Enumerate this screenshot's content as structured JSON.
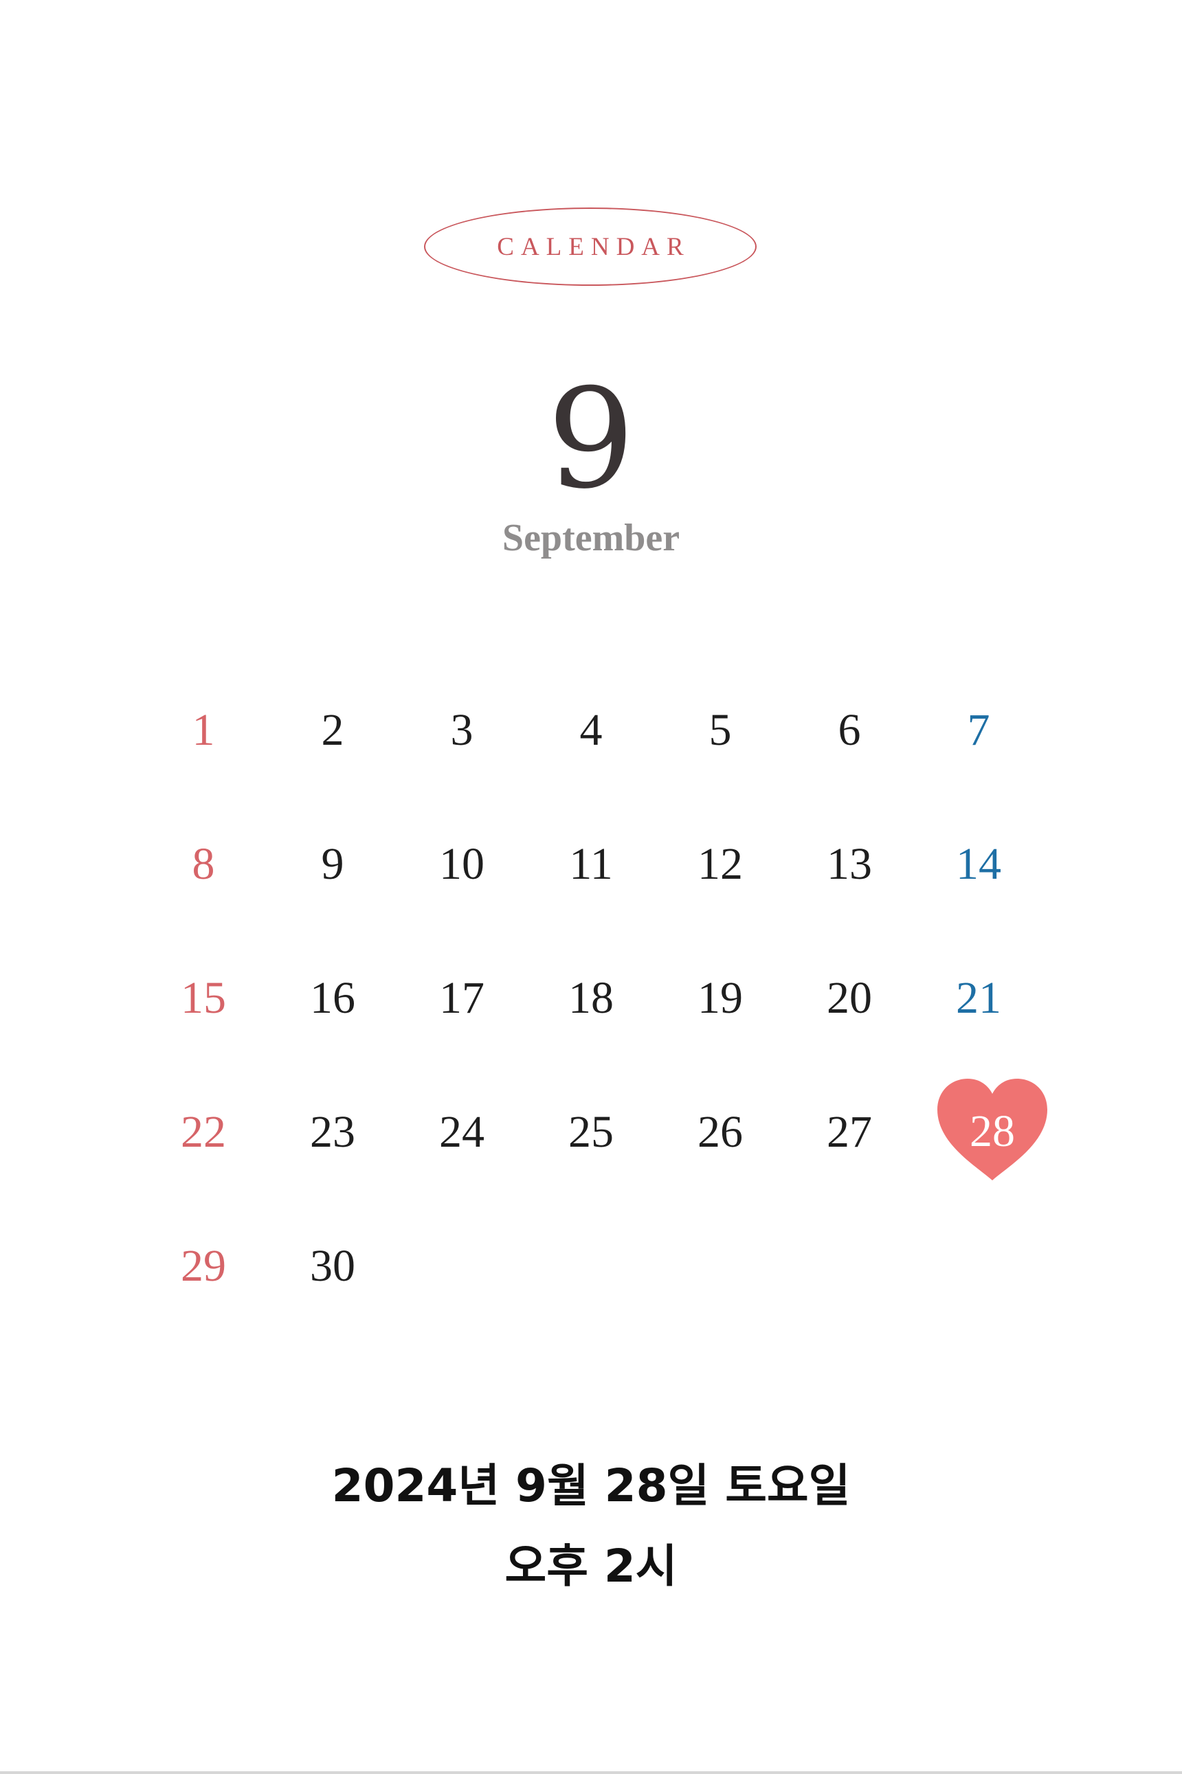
{
  "header": {
    "badge_label": "CALENDAR",
    "month_number": "9",
    "month_name": "September"
  },
  "calendar": {
    "days": [
      {
        "label": "1",
        "type": "sun"
      },
      {
        "label": "2",
        "type": "weekday"
      },
      {
        "label": "3",
        "type": "weekday"
      },
      {
        "label": "4",
        "type": "weekday"
      },
      {
        "label": "5",
        "type": "weekday"
      },
      {
        "label": "6",
        "type": "weekday"
      },
      {
        "label": "7",
        "type": "sat"
      },
      {
        "label": "8",
        "type": "sun"
      },
      {
        "label": "9",
        "type": "weekday"
      },
      {
        "label": "10",
        "type": "weekday"
      },
      {
        "label": "11",
        "type": "weekday"
      },
      {
        "label": "12",
        "type": "weekday"
      },
      {
        "label": "13",
        "type": "weekday"
      },
      {
        "label": "14",
        "type": "sat"
      },
      {
        "label": "15",
        "type": "sun"
      },
      {
        "label": "16",
        "type": "weekday"
      },
      {
        "label": "17",
        "type": "weekday"
      },
      {
        "label": "18",
        "type": "weekday"
      },
      {
        "label": "19",
        "type": "weekday"
      },
      {
        "label": "20",
        "type": "weekday"
      },
      {
        "label": "21",
        "type": "sat"
      },
      {
        "label": "22",
        "type": "sun"
      },
      {
        "label": "23",
        "type": "weekday"
      },
      {
        "label": "24",
        "type": "weekday"
      },
      {
        "label": "25",
        "type": "weekday"
      },
      {
        "label": "26",
        "type": "weekday"
      },
      {
        "label": "27",
        "type": "weekday"
      },
      {
        "label": "28",
        "type": "sat",
        "highlighted": true
      },
      {
        "label": "29",
        "type": "sun"
      },
      {
        "label": "30",
        "type": "weekday"
      }
    ],
    "highlight_icon": "heart-icon"
  },
  "footer": {
    "date_text": "2024년 9월 28일 토요일",
    "time_text": "오후 2시"
  },
  "colors": {
    "accent": "#c9575c",
    "sunday": "#d66468",
    "saturday": "#1e6fa5",
    "heart": "#ef7372",
    "text": "#1e1e1e",
    "month_name": "#8f8d8d"
  }
}
